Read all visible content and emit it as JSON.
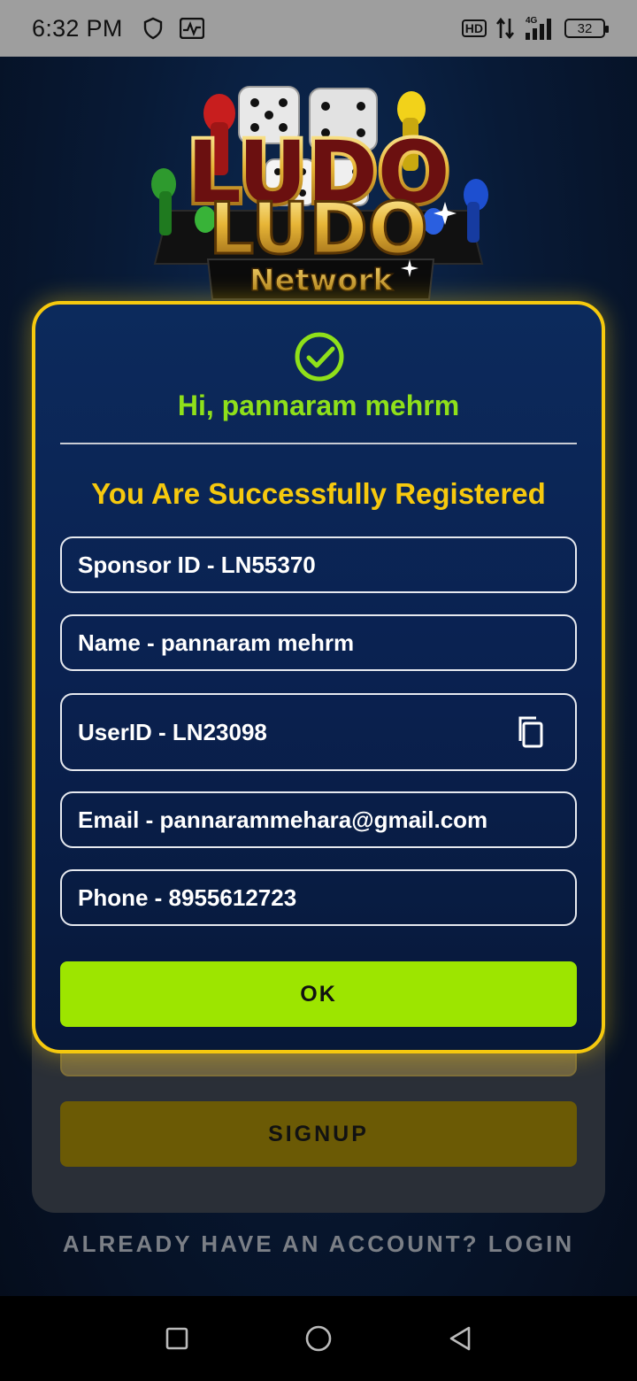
{
  "status_bar": {
    "time": "6:32 PM",
    "left_icons": [
      "shield-icon",
      "activity-icon"
    ],
    "network": "4G",
    "hd": "HD",
    "battery": "32"
  },
  "logo": {
    "title_top": "LUDO",
    "title_main": "LUDO",
    "subtitle": "Network"
  },
  "modal": {
    "greeting": "Hi, pannaram mehrm",
    "title": "You Are Successfully Registered",
    "fields": {
      "sponsor": "Sponsor ID - LN55370",
      "name": "Name - pannaram mehrm",
      "userid": "UserID - LN23098",
      "email": "Email - pannarammehara@gmail.com",
      "phone": "Phone - 8955612723"
    },
    "ok_label": "OK"
  },
  "background_form": {
    "signup_label": "SIGNUP",
    "login_link": "ALREADY HAVE AN ACCOUNT? LOGIN"
  },
  "colors": {
    "accent_yellow": "#f6c90e",
    "accent_green": "#9de500",
    "greeting_green": "#8fe01a",
    "modal_bg": "#0a2150"
  }
}
